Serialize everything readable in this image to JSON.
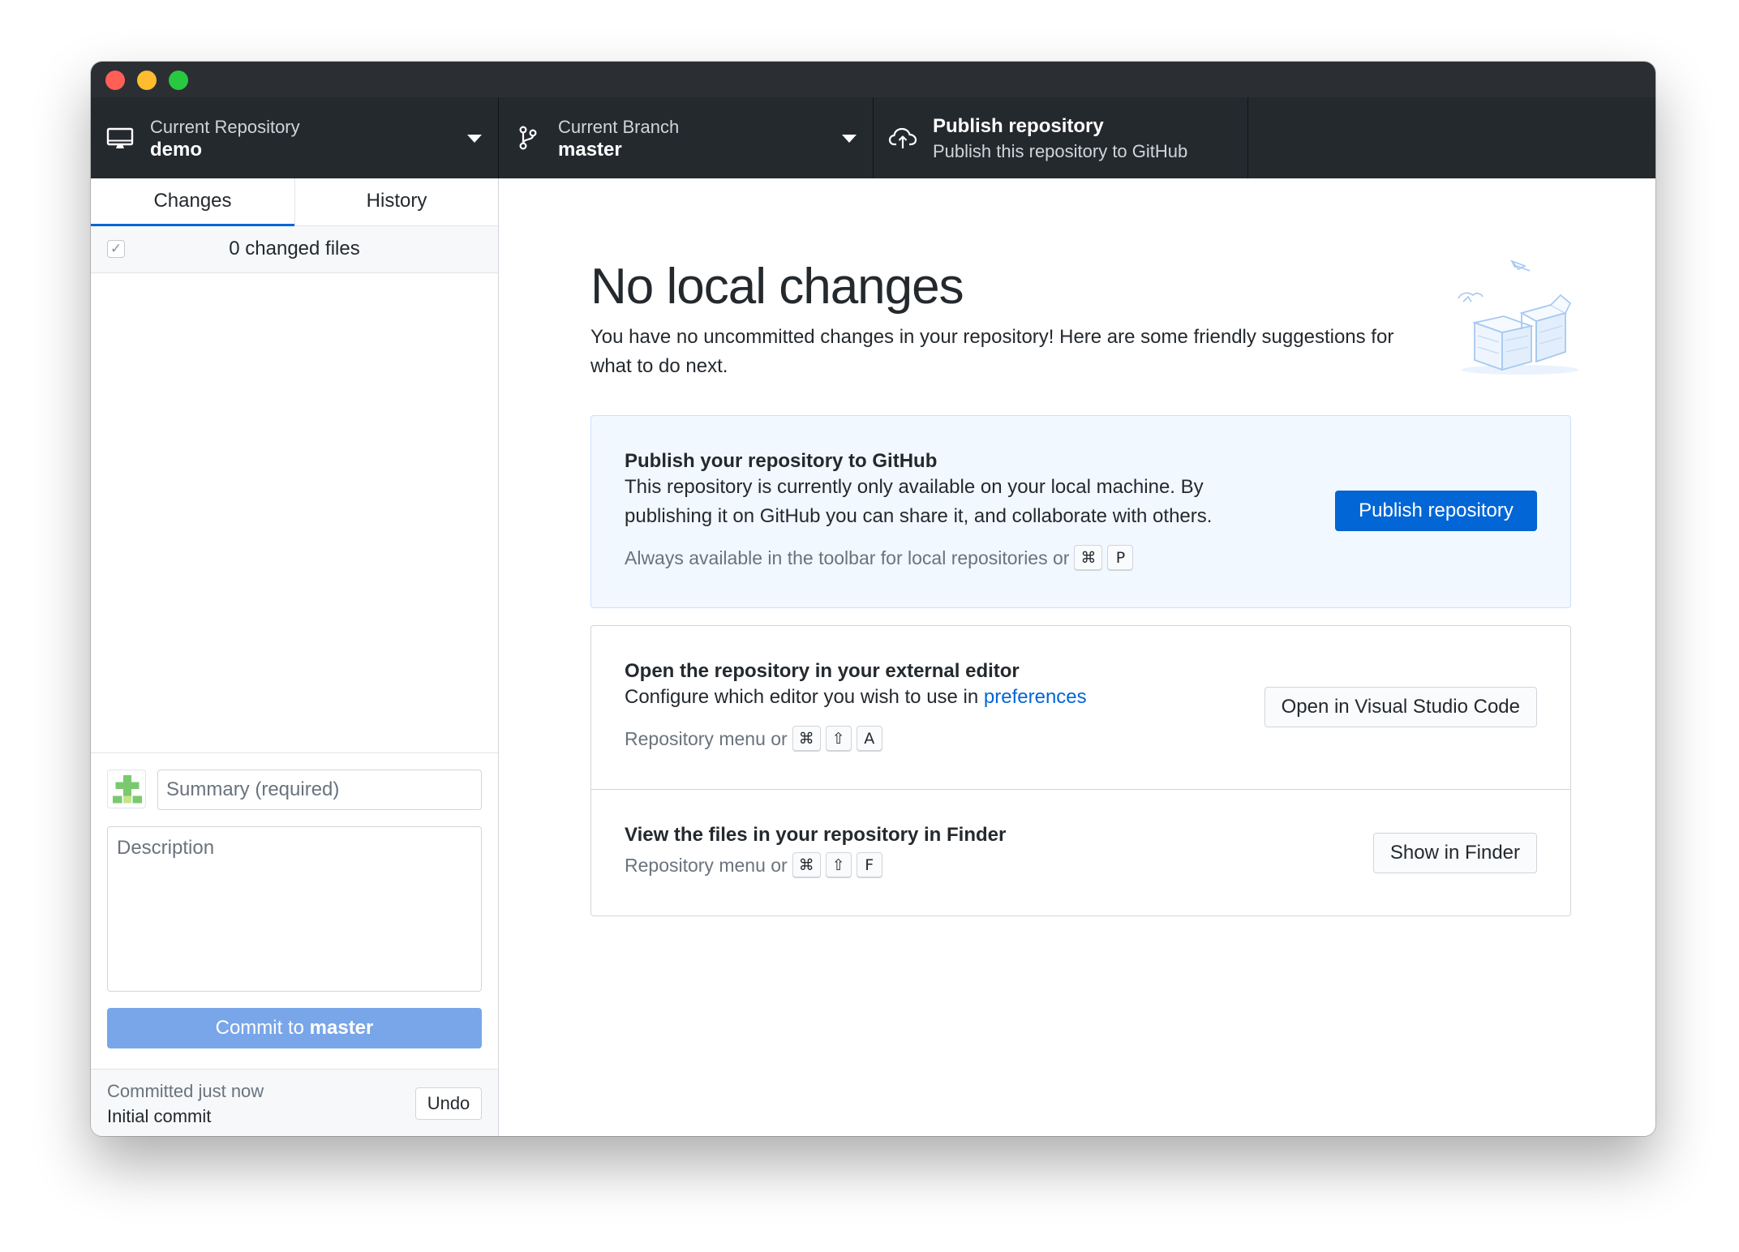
{
  "toolbar": {
    "repository": {
      "label": "Current Repository",
      "value": "demo",
      "icon": "desktop-icon"
    },
    "branch": {
      "label": "Current Branch",
      "value": "master",
      "icon": "git-branch-icon"
    },
    "publish": {
      "label": "Publish repository",
      "description": "Publish this repository to GitHub",
      "icon": "cloud-upload-icon"
    }
  },
  "sidebar": {
    "tabs": [
      {
        "label": "Changes",
        "active": true
      },
      {
        "label": "History",
        "active": false
      }
    ],
    "changed_files_label": "0 changed files",
    "commit": {
      "summary_placeholder": "Summary (required)",
      "description_placeholder": "Description",
      "button_prefix": "Commit to",
      "button_branch": "master"
    },
    "last_commit": {
      "time": "Committed just now",
      "message": "Initial commit",
      "undo_label": "Undo"
    }
  },
  "main": {
    "headline": "No local changes",
    "subtitle": "You have no uncommitted changes in your repository! Here are some friendly suggestions for what to do next.",
    "cards": {
      "publish": {
        "title": "Publish your repository to GitHub",
        "body": "This repository is currently only available on your local machine. By publishing it on GitHub you can share it, and collaborate with others.",
        "hint": "Always available in the toolbar for local repositories or",
        "keys": [
          "⌘",
          "P"
        ],
        "button": "Publish repository"
      },
      "editor": {
        "title": "Open the repository in your external editor",
        "body_prefix": "Configure which editor you wish to use in",
        "body_link": "preferences",
        "hint": "Repository menu or",
        "keys": [
          "⌘",
          "⇧",
          "A"
        ],
        "button": "Open in Visual Studio Code"
      },
      "finder": {
        "title": "View the files in your repository in Finder",
        "hint": "Repository menu or",
        "keys": [
          "⌘",
          "⇧",
          "F"
        ],
        "button": "Show in Finder"
      }
    }
  },
  "colors": {
    "toolbar_bg": "#24292e",
    "accent_blue": "#0366d6",
    "commit_button_disabled": "#79a6e9",
    "publish_card_bg": "#f1f8ff"
  }
}
